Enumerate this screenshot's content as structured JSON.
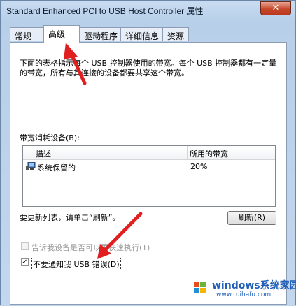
{
  "window": {
    "title": "Standard Enhanced PCI to USB Host Controller 属性",
    "close_glyph": "✕"
  },
  "tabs": [
    {
      "label": "常规"
    },
    {
      "label": "高级"
    },
    {
      "label": "驱动程序"
    },
    {
      "label": "详细信息"
    },
    {
      "label": "资源"
    }
  ],
  "active_tab": "高级",
  "advanced": {
    "description": "下面的表格指示每个 USB 控制器使用的带宽。每个 USB 控制器都有一定量的带宽，所有与其连接的设备都要共享这个带宽。",
    "group_label": "带宽消耗设备(B):",
    "table": {
      "columns": [
        "描述",
        "所用的带宽"
      ],
      "rows": [
        {
          "name": "系统保留的",
          "bandwidth": "20%"
        }
      ]
    },
    "refresh_hint": "要更新列表，请单击“刷新”。",
    "refresh_button": "刷新(R)",
    "option_fast": {
      "label": "告诉我设备是否可以更快速执行(T)",
      "checked": false,
      "enabled": false
    },
    "option_no_error": {
      "label": "不要通知我 USB 错误(D)",
      "checked": true,
      "enabled": true
    }
  },
  "watermark": {
    "brand": "windows系统家园",
    "site": "www.ruihafu.com"
  },
  "colors": {
    "arrow": "#e02020",
    "watermark_blue": "#1f5fb8"
  }
}
